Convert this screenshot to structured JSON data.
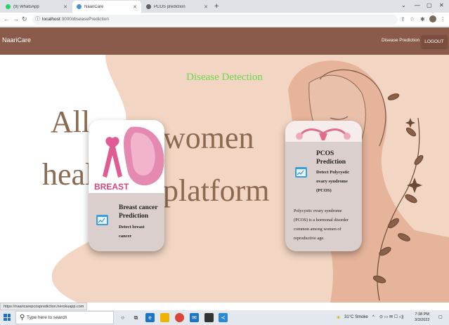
{
  "browser": {
    "tabs": [
      {
        "title": "(9) WhatsApp",
        "favicon_color": "#25d366",
        "active": false
      },
      {
        "title": "NaariCare",
        "favicon_color": "#4a90d9",
        "active": true
      },
      {
        "title": "PCOS prediction",
        "favicon_color": "#5f6368",
        "active": false
      }
    ],
    "new_tab_icon": "plus-icon",
    "address": {
      "host": "localhost",
      "path": ":3000/diseasePrediction"
    }
  },
  "navbar": {
    "brand": "NaariCare",
    "link": "Disease Prediction",
    "logout": "LOGOUT",
    "bg_color": "#8a5a4a"
  },
  "hero": {
    "heading": "Disease Detection",
    "heading_color": "#6bd94b",
    "background_text": {
      "line1_left": "All",
      "line1_right": "women",
      "line2_left": "healt",
      "line2_right": "platform"
    },
    "cards": [
      {
        "image_text": "BREAST",
        "title_line1": "Breast cancer",
        "title_line2": "Prediction",
        "subtitle_line1": "Detect breast",
        "subtitle_line2": "cancer",
        "icon": "chart-icon"
      },
      {
        "title_line1": "PCOS",
        "title_line2": "Prediction",
        "subtitle_line1": "Detect Polycystic",
        "subtitle_line2": "ovary syndrome",
        "subtitle_line3": "(PCOS)",
        "description_lines": [
          "Polycystic ovary syndrome",
          "(PCOS) is a hormonal disorder",
          "common among women of",
          "reproductive age."
        ],
        "icon": "chart-icon"
      }
    ]
  },
  "status_url": "https://naaricarepcosprediction.herokuapp.com",
  "taskbar": {
    "search_placeholder": "Type here to search",
    "weather": "31°C  Smoke",
    "time": "7:38 PM",
    "date": "3/3/2022"
  }
}
